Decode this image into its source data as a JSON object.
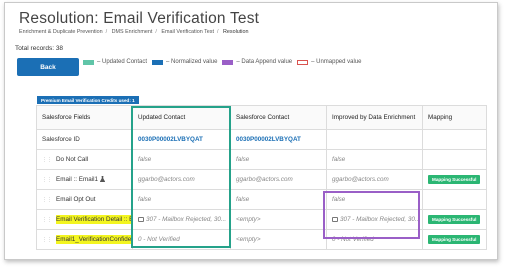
{
  "page": {
    "title": "Resolution: Email Verification Test",
    "breadcrumb": [
      "Enrichment & Duplicate Prevention",
      "DMS Enrichment",
      "Email Verification Test",
      "Resolution"
    ],
    "total_records": "Total records: 38"
  },
  "toolbar": {
    "back_label": "Back"
  },
  "legend": [
    {
      "label": "– Updated Contact",
      "color": "#60c5a8"
    },
    {
      "label": "– Normalized value",
      "color": "#1b6fb5"
    },
    {
      "label": "– Data Append value",
      "color": "#9a5fc7"
    },
    {
      "label": "– Unmapped value",
      "color": "#d9534f"
    }
  ],
  "credits_label": "Premium Email Verification Credits used: 1",
  "table": {
    "headers": [
      "Salesforce Fields",
      "Updated Contact",
      "Salesforce Contact",
      "Improved by Data Enrichment",
      "Mapping"
    ],
    "rows": [
      {
        "field": "Salesforce ID",
        "updated": "0030P00002LVBYQAT",
        "sf": "0030P00002LVBYQAT",
        "improved": "",
        "mapping": ""
      },
      {
        "field": "Do Not Call",
        "updated": "false",
        "sf": "false",
        "improved": "false",
        "mapping": ""
      },
      {
        "field": "Email :: Email1",
        "updated": "ggarbo@actors.com",
        "sf": "ggarbo@actors.com",
        "improved": "ggarbo@actors.com",
        "mapping": "Mapping Successful"
      },
      {
        "field": "Email Opt Out",
        "updated": "false",
        "sf": "false",
        "improved": "false",
        "mapping": ""
      },
      {
        "field": "Email Verification Detail :: E...",
        "updated": "307 - Mailbox Rejected, 30...",
        "sf": "<empty>",
        "improved": "307 - Mailbox Rejected, 30...",
        "mapping": "Mapping Successful"
      },
      {
        "field": "Email1_VerificationConfide...",
        "updated": "0 - Not Verified",
        "sf": "<empty>",
        "improved": "0 - Not Verified",
        "mapping": "Mapping Successful"
      }
    ]
  },
  "colors": {
    "accent": "#1b6fb5",
    "updated_outline": "#25a28a",
    "append_outline": "#9a5fc7",
    "success": "#2bb673",
    "highlight": "#f3f520"
  }
}
